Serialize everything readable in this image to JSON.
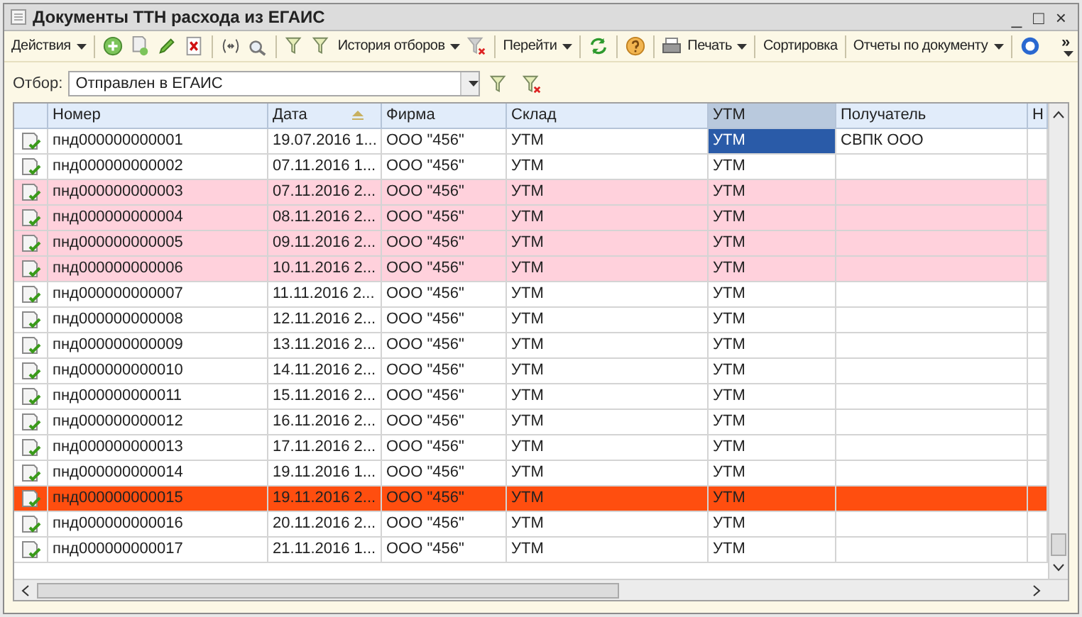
{
  "window": {
    "title": "Документы ТТН расхода из ЕГАИС",
    "controls": [
      "_",
      "□",
      "×"
    ]
  },
  "toolbar": {
    "actions": "Действия",
    "history": "История отборов",
    "goto": "Перейти",
    "print": "Печать",
    "sort": "Сортировка",
    "reports": "Отчеты по документу",
    "overflow": "»"
  },
  "filter": {
    "label": "Отбор:",
    "value": "Отправлен в ЕГАИС"
  },
  "table": {
    "columns": [
      {
        "selected": false,
        "sorted": false
      },
      {
        "label": "Номер",
        "selected": false,
        "sorted": false
      },
      {
        "label": "Дата",
        "selected": false,
        "sorted": true
      },
      {
        "label": "Фирма",
        "selected": false,
        "sorted": false
      },
      {
        "label": "Склад",
        "selected": false,
        "sorted": false
      },
      {
        "label": "УТМ",
        "selected": true,
        "sorted": false
      },
      {
        "label": "Получатель",
        "selected": false,
        "sorted": false
      },
      {
        "label": "Н",
        "selected": false
      }
    ],
    "rows": [
      {
        "number": "пнд000000000001",
        "date": "19.07.2016 1...",
        "firm": "ООО \"456\"",
        "warehouse": "УТМ",
        "utm": "УТМ",
        "recipient": "СВПК ООО",
        "color": "#ffffff",
        "selected": true
      },
      {
        "number": "пнд000000000002",
        "date": "07.11.2016 1...",
        "firm": "ООО \"456\"",
        "warehouse": "УТМ",
        "utm": "УТМ",
        "color": "#ffffff",
        "selected": false
      },
      {
        "number": "пнд000000000003",
        "date": "07.11.2016 2...",
        "firm": "ООО \"456\"",
        "warehouse": "УТМ",
        "utm": "УТМ",
        "color": "#ffd1dc",
        "selected": false
      },
      {
        "number": "пнд000000000004",
        "date": "08.11.2016 2...",
        "firm": "ООО \"456\"",
        "warehouse": "УТМ",
        "utm": "УТМ",
        "color": "#ffd1dc",
        "selected": false
      },
      {
        "number": "пнд000000000005",
        "date": "09.11.2016 2...",
        "firm": "ООО \"456\"",
        "warehouse": "УТМ",
        "utm": "УТМ",
        "color": "#ffd1dc",
        "selected": false
      },
      {
        "number": "пнд000000000006",
        "date": "10.11.2016 2...",
        "firm": "ООО \"456\"",
        "warehouse": "УТМ",
        "utm": "УТМ",
        "color": "#ffd1dc",
        "selected": false
      },
      {
        "number": "пнд000000000007",
        "date": "11.11.2016 2...",
        "firm": "ООО \"456\"",
        "warehouse": "УТМ",
        "utm": "УТМ",
        "color": "#ffffff",
        "selected": false
      },
      {
        "number": "пнд000000000008",
        "date": "12.11.2016 2...",
        "firm": "ООО \"456\"",
        "warehouse": "УТМ",
        "utm": "УТМ",
        "color": "#ffffff",
        "selected": false
      },
      {
        "number": "пнд000000000009",
        "date": "13.11.2016 2...",
        "firm": "ООО \"456\"",
        "warehouse": "УТМ",
        "utm": "УТМ",
        "color": "#ffffff",
        "selected": false
      },
      {
        "number": "пнд000000000010",
        "date": "14.11.2016 2...",
        "firm": "ООО \"456\"",
        "warehouse": "УТМ",
        "utm": "УТМ",
        "color": "#ffffff",
        "selected": false
      },
      {
        "number": "пнд000000000011",
        "date": "15.11.2016 2...",
        "firm": "ООО \"456\"",
        "warehouse": "УТМ",
        "utm": "УТМ",
        "color": "#ffffff",
        "selected": false
      },
      {
        "number": "пнд000000000012",
        "date": "16.11.2016 2...",
        "firm": "ООО \"456\"",
        "warehouse": "УТМ",
        "utm": "УТМ",
        "color": "#ffffff",
        "selected": false
      },
      {
        "number": "пнд000000000013",
        "date": "17.11.2016 2...",
        "firm": "ООО \"456\"",
        "warehouse": "УТМ",
        "utm": "УТМ",
        "color": "#ffffff",
        "selected": false
      },
      {
        "number": "пнд000000000014",
        "date": "19.11.2016 1...",
        "firm": "ООО \"456\"",
        "warehouse": "УТМ",
        "utm": "УТМ",
        "color": "#ffffff",
        "selected": false
      },
      {
        "number": "пнд000000000015",
        "date": "19.11.2016 2...",
        "firm": "ООО \"456\"",
        "warehouse": "УТМ",
        "utm": "УТМ",
        "color": "#ff4e0f",
        "selected": false
      },
      {
        "number": "пнд000000000016",
        "date": "20.11.2016 2...",
        "firm": "ООО \"456\"",
        "warehouse": "УТМ",
        "utm": "УТМ",
        "color": "#ffffff",
        "selected": false
      },
      {
        "number": "пнд000000000017",
        "date": "21.11.2016 1...",
        "firm": "ООО \"456\"",
        "warehouse": "УТМ",
        "utm": "УТМ",
        "color": "#ffffff",
        "selected": false
      }
    ]
  }
}
